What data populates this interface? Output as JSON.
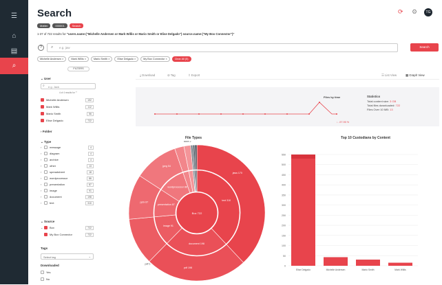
{
  "app": {
    "title": "Search"
  },
  "rail": {
    "icons": [
      "menu-icon",
      "home-icon",
      "database-icon",
      "search-icon"
    ]
  },
  "header": {
    "avatar_initials": "TG"
  },
  "breadcrumbs": [
    "Matter",
    "000001",
    "Search"
  ],
  "results": {
    "prefix": "1-37 of 722 results for",
    "query": "\"users.name:(\"Michelle Andersen or Mark Willis or Mario Smith or Elise Delgado\") source.name:(\"My Box Connector\")\""
  },
  "search": {
    "placeholder": "e.g. jaw",
    "button_label": "Search"
  },
  "chips": [
    "Michelle Andersen ×",
    "Mark Willis ×",
    "Mario Smith ×",
    "Elise Delgado ×",
    "My Box Connector ×",
    "Clear All (5)"
  ],
  "filters": {
    "title": "FILTERS",
    "user_label": "User",
    "user_placeholder": "e.g. Jack",
    "user_hint": "4 of 4 results for \"\"",
    "users": [
      {
        "name": "Michelle Andersen",
        "count": "192"
      },
      {
        "name": "Mark Willis",
        "count": "112"
      },
      {
        "name": "Mario Smith",
        "count": "56"
      },
      {
        "name": "Elise Delgado",
        "count": "722"
      }
    ],
    "folder_label": "Folder",
    "type_label": "Type",
    "types": [
      {
        "name": "message",
        "count": "4"
      },
      {
        "name": "diagram",
        "count": "4"
      },
      {
        "name": "archive",
        "count": "4"
      },
      {
        "name": "other",
        "count": "13"
      },
      {
        "name": "spreadsheet",
        "count": "18"
      },
      {
        "name": "wordprocessor",
        "count": "86"
      },
      {
        "name": "presentation",
        "count": "87"
      },
      {
        "name": "image",
        "count": "91"
      },
      {
        "name": "document",
        "count": "198"
      },
      {
        "name": "text",
        "count": "310"
      }
    ],
    "source_label": "Source",
    "sources": [
      {
        "name": "Box",
        "count": "722"
      },
      {
        "name": "My Box Connector",
        "count": "722"
      }
    ],
    "tags_label": "Tags",
    "tags_placeholder": "Select tag",
    "downloaded_label": "Downloaded",
    "downloaded_options": [
      "Yes",
      "No"
    ]
  },
  "toolbar": {
    "download": "Download",
    "tag": "Tag",
    "export": "Export",
    "list_view": "List View",
    "graph_view": "Graph View"
  },
  "timeline": {
    "title": "Files by time",
    "change": "↓ -97.95 %",
    "stats_title": "Statistics",
    "total_size_label": "Total content size:",
    "total_size": "3 GB",
    "total_downloaded_label": "Total files downloaded:",
    "total_downloaded": "722",
    "over_label": "Files Over 10 MB:",
    "over": "13"
  },
  "chart_data": [
    {
      "type": "pie",
      "title": "File Types",
      "center_label": "Box 722",
      "values": [
        {
          "label": "text",
          "value": 310
        },
        {
          "label": "document",
          "value": 198
        },
        {
          "label": "image",
          "value": 91
        },
        {
          "label": "presentation",
          "value": 87
        },
        {
          "label": "wordprocessor",
          "value": 86
        },
        {
          "label": "spreadsheet",
          "value": 18
        },
        {
          "label": "other",
          "value": 13
        },
        {
          "label": "archive",
          "value": 4
        },
        {
          "label": "diagram",
          "value": 4
        },
        {
          "label": "message",
          "value": 4
        }
      ],
      "ring_labels": [
        "text 310",
        "document 198",
        "image 91",
        "presentation 87",
        "wordprocessor 86"
      ],
      "outer_labels": [
        "jaws 170",
        "pdf 198",
        "jpeg 54",
        "pptx 87",
        "docx 2",
        "pdf 1"
      ]
    },
    {
      "type": "bar",
      "title": "Top 10 Custodians by Content",
      "categories": [
        "Elise Delgado",
        "Michelle Andersen",
        "Mario Smith",
        "Mark Willis"
      ],
      "values": [
        550,
        42,
        30,
        15
      ],
      "ylim": [
        0,
        550
      ],
      "yticks": [
        "0",
        "50",
        "100",
        "150",
        "200",
        "250",
        "300",
        "350",
        "400",
        "450",
        "500",
        "550"
      ],
      "colors": {
        "bar": "#e8444c",
        "bar_top": "#d8333c"
      }
    }
  ],
  "colors": {
    "accent": "#e8444c",
    "rail": "#1f2a33"
  }
}
